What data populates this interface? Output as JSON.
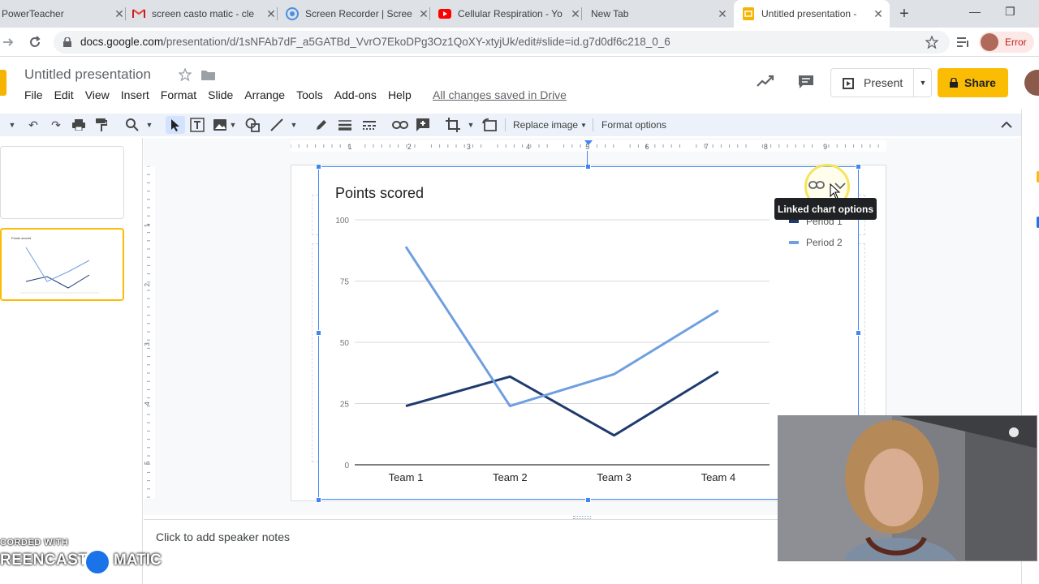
{
  "browser": {
    "tabs": [
      {
        "title": "PowerTeacher"
      },
      {
        "title": "screen casto matic - cle"
      },
      {
        "title": "Screen Recorder | Scree"
      },
      {
        "title": "Cellular Respiration - Yo"
      },
      {
        "title": "New Tab"
      },
      {
        "title": "Untitled presentation -"
      }
    ],
    "url_main": "docs.google.com",
    "url_rest": "/presentation/d/1sNFAb7dF_a5GATBd_VvrO7EkoDPg3Oz1QoXY-xtyjUk/edit#slide=id.g7d0df6c218_0_6",
    "profile_status": "Error"
  },
  "doc": {
    "title": "Untitled presentation",
    "menus": [
      "File",
      "Edit",
      "View",
      "Insert",
      "Format",
      "Slide",
      "Arrange",
      "Tools",
      "Add-ons",
      "Help"
    ],
    "save_status": "All changes saved in Drive",
    "present_label": "Present",
    "share_label": "Share"
  },
  "edit_toolbar": {
    "replace_image": "Replace image",
    "format_options": "Format options"
  },
  "ruler": {
    "top_numbers": [
      "1",
      "2",
      "3",
      "4",
      "5",
      "6",
      "7",
      "8",
      "9"
    ],
    "left_numbers": [
      "1",
      "2",
      "3",
      "4",
      "5"
    ]
  },
  "tooltip": "Linked chart options",
  "notes_placeholder": "Click to add speaker notes",
  "watermark": {
    "line1": "CORDED WITH",
    "line2a": "REENCAST",
    "line2b": "MATIC"
  },
  "colors": {
    "period1": "#1f3b6e",
    "period2": "#6f9fe0",
    "accent": "#fbbc04",
    "selection": "#4285f4"
  },
  "chart_data": {
    "type": "line",
    "title": "Points scored",
    "categories": [
      "Team 1",
      "Team 2",
      "Team 3",
      "Team 4"
    ],
    "series": [
      {
        "name": "Period 1",
        "values": [
          24,
          36,
          12,
          38
        ]
      },
      {
        "name": "Period 2",
        "values": [
          89,
          24,
          37,
          63
        ]
      }
    ],
    "ylim": [
      0,
      100
    ],
    "yticks": [
      0,
      25,
      50,
      75,
      100
    ],
    "grid": true,
    "legend": "top-right"
  }
}
